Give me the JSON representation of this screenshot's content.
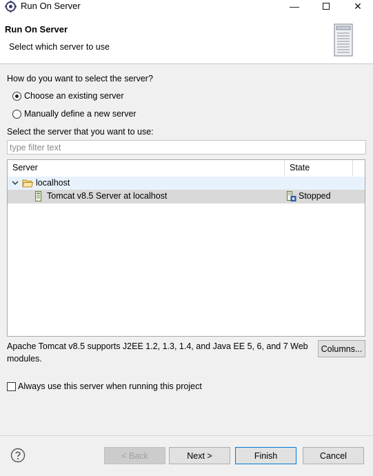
{
  "window": {
    "title": "Run On Server",
    "minimize_symbol": "—",
    "close_symbol": "✕",
    "icons": {
      "app": "server-gear-icon",
      "minimize": "minimize-icon",
      "maximize": "maximize-icon",
      "close": "close-icon"
    }
  },
  "header": {
    "title": "Run On Server",
    "description": "Select which server to use",
    "graphic": "server-tower-icon"
  },
  "selection": {
    "question": "How do you want to select the server?",
    "options": [
      {
        "label": "Choose an existing server",
        "checked": true
      },
      {
        "label": "Manually define a new server",
        "checked": false
      }
    ],
    "list_label": "Select the server that you want to use:",
    "filter_placeholder": "type filter text",
    "filter_value": ""
  },
  "server_table": {
    "columns": [
      "Server",
      "State"
    ],
    "group": {
      "name": "localhost",
      "expanded": true,
      "icon": "folder-open-icon"
    },
    "rows": [
      {
        "server": "Tomcat v8.5 Server at localhost",
        "state": "Stopped",
        "selected": true,
        "server_icon": "server-icon",
        "state_icon": "server-stopped-icon"
      }
    ]
  },
  "description": "Apache Tomcat v8.5 supports J2EE 1.2, 1.3, 1.4, and Java EE 5, 6, and 7 Web modules.",
  "columns_button": "Columns...",
  "always_use_checkbox": {
    "label": "Always use this server when running this project",
    "checked": false
  },
  "footer": {
    "help_icon": "help-icon",
    "back": "< Back",
    "back_enabled": false,
    "next": "Next >",
    "finish": "Finish",
    "cancel": "Cancel"
  },
  "colors": {
    "dialog_background": "#f0f0f0",
    "header_background": "#ffffff",
    "hover_row": "#e8f2fd",
    "selected_row": "#d9d9d9",
    "default_button_border": "#0078d7"
  }
}
